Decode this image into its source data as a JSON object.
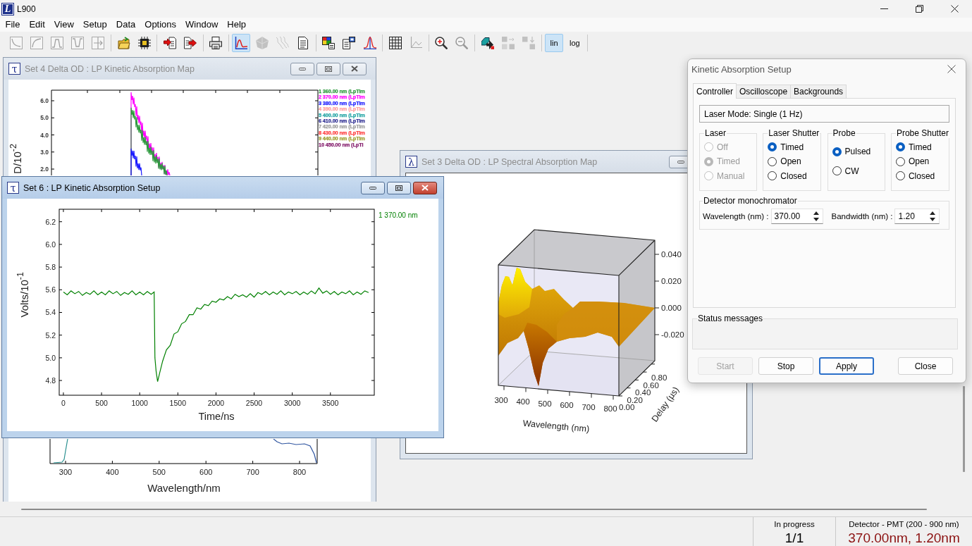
{
  "app": {
    "logo": "L",
    "title": "L900"
  },
  "menu": [
    "File",
    "Edit",
    "View",
    "Setup",
    "Data",
    "Options",
    "Window",
    "Help"
  ],
  "toolbar": {
    "groups": [
      [
        {
          "selected": false,
          "disabled": true
        },
        {
          "selected": false,
          "disabled": true
        },
        {
          "selected": false,
          "disabled": true
        },
        {
          "selected": false,
          "disabled": true
        },
        {
          "selected": false,
          "disabled": true
        }
      ],
      [
        {
          "selected": false,
          "disabled": false
        },
        {
          "selected": false,
          "disabled": false
        }
      ],
      [
        {
          "selected": false,
          "disabled": false
        },
        {
          "selected": false,
          "disabled": false
        }
      ],
      [
        {
          "selected": false,
          "disabled": false
        }
      ],
      [
        {
          "selected": true,
          "disabled": false
        },
        {
          "selected": false,
          "disabled": true
        },
        {
          "selected": false,
          "disabled": true
        },
        {
          "selected": false,
          "disabled": false
        }
      ],
      [
        {
          "selected": false,
          "disabled": false
        },
        {
          "selected": false,
          "disabled": false
        },
        {
          "selected": false,
          "disabled": false
        }
      ],
      [
        {
          "selected": false,
          "disabled": false
        },
        {
          "selected": false,
          "disabled": true
        }
      ],
      [
        {
          "selected": false,
          "disabled": false
        },
        {
          "selected": false,
          "disabled": true
        }
      ],
      [
        {
          "selected": false,
          "disabled": false
        },
        {
          "selected": false,
          "disabled": true
        },
        {
          "selected": false,
          "disabled": true
        }
      ]
    ],
    "scale": [
      {
        "label": "lin",
        "selected": true
      },
      {
        "label": "log",
        "selected": false
      }
    ]
  },
  "set4_window": {
    "icon": "τ",
    "title": "Set 4 Delta OD : LP Kinetic Absorption Map",
    "active": false,
    "ylabel": "D/10$^{-2}$",
    "yticks": [
      "6.0",
      "5.0",
      "4.0",
      "3.0",
      "2.0"
    ],
    "legend": [
      {
        "label": "1 360.00 nm (LpTim",
        "color": "#2e9a3e"
      },
      {
        "label": "2 370.00 nm (LpTim",
        "color": "#ff00ff"
      },
      {
        "label": "3 380.00 nm (LpTim",
        "color": "#1a1aff"
      },
      {
        "label": "4 390.00 nm (LpTim",
        "color": "#ff9c9c"
      },
      {
        "label": "5 400.00 nm (LpTim",
        "color": "#1fa3a3"
      },
      {
        "label": "6 410.00 nm (LpTim",
        "color": "#2e2e92"
      },
      {
        "label": "7 420.00 nm (LpTim",
        "color": "#9c9c9c"
      },
      {
        "label": "8 430.00 nm (LpTim",
        "color": "#ff3c3c"
      },
      {
        "label": "9 440.00 nm (LpTim",
        "color": "#9e9e2e"
      },
      {
        "label": "10 450.00 nm (LpTi",
        "color": "#86206e"
      }
    ],
    "lower_chart": {
      "xticks": [
        "300",
        "400",
        "500",
        "600",
        "700",
        "800"
      ],
      "xlabel": "Wavelength/nm"
    }
  },
  "set3_window": {
    "icon": "λ",
    "title": "Set 3 Delta OD : LP Spectral Absorption Map",
    "active": false,
    "z_ticks": [
      "0.040",
      "0.020",
      "0.000",
      "-0.020"
    ],
    "wavelength_ticks": [
      "300",
      "400",
      "500",
      "600",
      "700",
      "800"
    ],
    "delay_ticks": [
      "0.00",
      "0.20",
      "0.40",
      "0.60",
      "0.80"
    ],
    "xlabel": "Wavelength (nm)",
    "delay_label": "Delay (µs)"
  },
  "set6_window": {
    "icon": "τ",
    "title": "Set 6 : LP Kinetic Absorption Setup",
    "active": true,
    "chart_data": {
      "type": "line",
      "xlabel": "Time/ns",
      "ylabel": "Volts/10$^{-1}$",
      "x": [
        0,
        50,
        100,
        150,
        200,
        250,
        300,
        350,
        400,
        450,
        500,
        550,
        600,
        650,
        700,
        750,
        800,
        850,
        900,
        950,
        1000,
        1050,
        1100,
        1150,
        1190,
        1200,
        1215,
        1235,
        1260,
        1300,
        1350,
        1400,
        1450,
        1500,
        1550,
        1600,
        1650,
        1700,
        1750,
        1800,
        1850,
        1900,
        1950,
        2000,
        2050,
        2100,
        2150,
        2200,
        2250,
        2300,
        2350,
        2400,
        2450,
        2500,
        2550,
        2600,
        2650,
        2700,
        2750,
        2800,
        2850,
        2900,
        2950,
        3000,
        3050,
        3100,
        3150,
        3200,
        3250,
        3300,
        3350,
        3400,
        3450,
        3500,
        3550,
        3600,
        3650,
        3700,
        3750,
        3800,
        3850,
        3900,
        3950,
        4000
      ],
      "series": [
        {
          "name": "1 370.00 nm",
          "color": "#008000",
          "values": [
            5.58,
            5.555,
            5.59,
            5.565,
            5.585,
            5.55,
            5.575,
            5.56,
            5.59,
            5.555,
            5.58,
            5.555,
            5.59,
            5.565,
            5.585,
            5.55,
            5.575,
            5.56,
            5.59,
            5.555,
            5.58,
            5.555,
            5.585,
            5.56,
            5.58,
            5.0,
            4.88,
            4.79,
            4.86,
            4.97,
            5.07,
            5.11,
            5.21,
            5.23,
            5.3,
            5.32,
            5.38,
            5.38,
            5.44,
            5.43,
            5.47,
            5.46,
            5.5,
            5.49,
            5.52,
            5.51,
            5.54,
            5.52,
            5.56,
            5.54,
            5.555,
            5.535,
            5.565,
            5.535,
            5.575,
            5.56,
            5.585,
            5.555,
            5.58,
            5.56,
            5.59,
            5.555,
            5.58,
            5.565,
            5.585,
            5.555,
            5.58,
            5.56,
            5.59,
            5.565,
            5.615,
            5.57,
            5.59,
            5.56,
            5.585,
            5.555,
            5.58,
            5.565,
            5.59,
            5.555,
            5.58,
            5.56,
            5.59,
            5.575
          ]
        }
      ],
      "xlim": [
        -55,
        4075
      ],
      "ylim": [
        4.67,
        6.31
      ],
      "xticks": [
        0,
        500,
        1000,
        1500,
        2000,
        2500,
        3000,
        3500
      ],
      "yticks": [
        {
          "value": 4.8,
          "label": "4.8"
        },
        {
          "value": 5.0,
          "label": "5.0"
        },
        {
          "value": 5.2,
          "label": "5.2"
        },
        {
          "value": 5.4,
          "label": "5.4"
        },
        {
          "value": 5.6,
          "label": "5.6"
        },
        {
          "value": 5.8,
          "label": "5.8"
        },
        {
          "value": 6.0,
          "label": "6.0"
        },
        {
          "value": 6.2,
          "label": "6.2"
        }
      ]
    }
  },
  "dialog": {
    "title": "Kinetic Absorption Setup",
    "tabs": [
      {
        "label": "Controller",
        "selected": true
      },
      {
        "label": "Oscilloscope",
        "selected": false
      },
      {
        "label": "Backgrounds",
        "selected": false
      }
    ],
    "laser_mode": "Laser Mode: Single (1 Hz)",
    "groups": [
      {
        "title": "Laser",
        "options": [
          {
            "label": "Off",
            "selected": false,
            "disabled": true
          },
          {
            "label": "Timed",
            "selected": true,
            "disabled": true
          },
          {
            "label": "Manual",
            "selected": false,
            "disabled": true
          }
        ]
      },
      {
        "title": "Laser Shutter",
        "options": [
          {
            "label": "Timed",
            "selected": true,
            "disabled": false
          },
          {
            "label": "Open",
            "selected": false,
            "disabled": false
          },
          {
            "label": "Closed",
            "selected": false,
            "disabled": false
          }
        ]
      },
      {
        "title": "Probe",
        "options": [
          {
            "label": "Pulsed",
            "selected": true,
            "disabled": false
          },
          {
            "label": "CW",
            "selected": false,
            "disabled": false
          }
        ]
      },
      {
        "title": "Probe Shutter",
        "options": [
          {
            "label": "Timed",
            "selected": true,
            "disabled": false
          },
          {
            "label": "Open",
            "selected": false,
            "disabled": false
          },
          {
            "label": "Closed",
            "selected": false,
            "disabled": false
          }
        ]
      }
    ],
    "monochromator": {
      "title": "Detector monochromator",
      "fields": [
        {
          "label": "Wavelength (nm) :",
          "value": "370.00"
        },
        {
          "label": "Bandwidth (nm) :",
          "value": "1.20"
        }
      ]
    },
    "status": {
      "title": "Status messages"
    },
    "buttons": [
      {
        "label": "Start",
        "disabled": true,
        "focused": false
      },
      {
        "label": "Stop",
        "disabled": false,
        "focused": false
      },
      {
        "label": "Apply",
        "disabled": false,
        "focused": true
      },
      {
        "label": "Close",
        "disabled": false,
        "focused": false
      }
    ]
  },
  "status_bar": {
    "panels": [
      {
        "label": "In progress",
        "value": "1/1"
      },
      {
        "label": "Detector - PMT (200 - 900 nm)",
        "value": "370.00nm, 1.20nm"
      }
    ]
  }
}
